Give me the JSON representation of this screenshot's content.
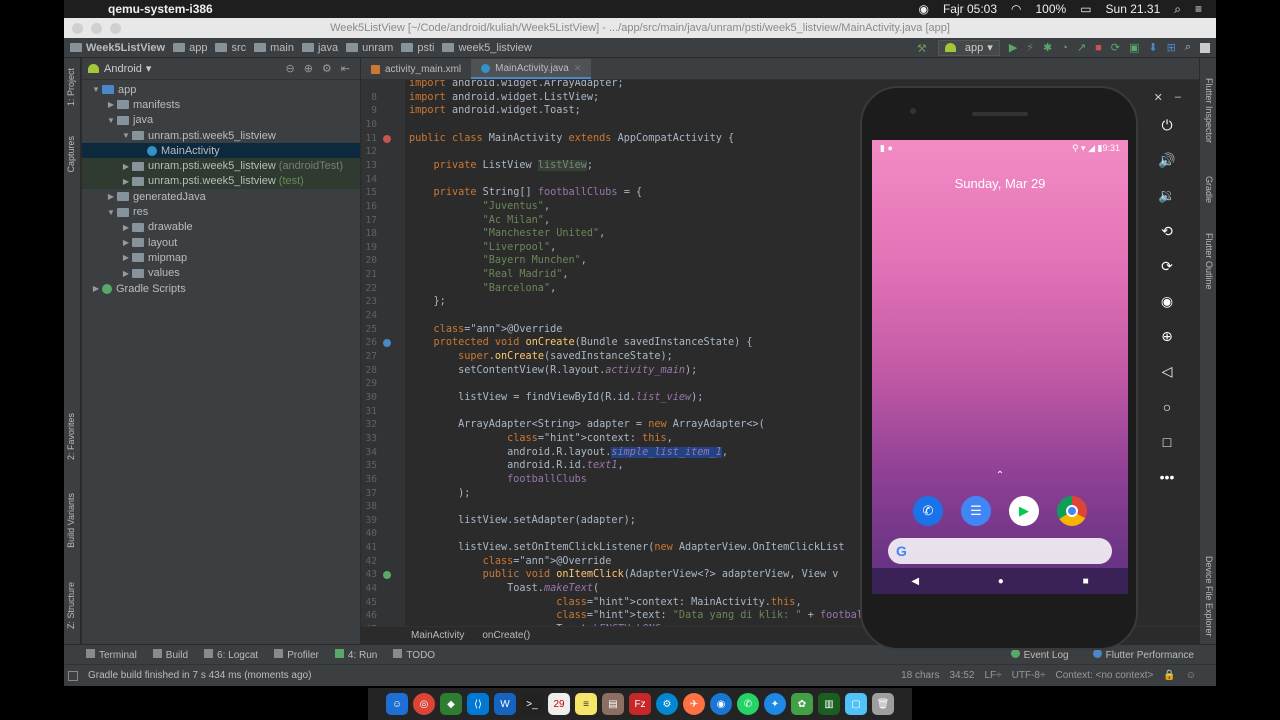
{
  "menubar": {
    "app_name": "qemu-system-i386",
    "prayer": "Fajr 05:03",
    "battery": "100%",
    "clock": "Sun 21.31"
  },
  "window": {
    "title": "Week5ListView [~/Code/android/kuliah/Week5ListView] - .../app/src/main/java/unram/psti/week5_listview/MainActivity.java [app]"
  },
  "navbar": {
    "crumbs": [
      "Week5ListView",
      "app",
      "src",
      "main",
      "java",
      "unram",
      "psti",
      "week5_listview"
    ],
    "run_config": "app"
  },
  "side_tabs": {
    "left": [
      "1: Project",
      "Captures",
      "2: Favorites",
      "Build Variants",
      "Z: Structure"
    ],
    "right": [
      "Flutter Inspector",
      "Gradle",
      "Flutter Outline",
      "Device File Explorer"
    ]
  },
  "project": {
    "view": "Android",
    "tree": [
      {
        "label": "app",
        "suffix": "",
        "depth": 0,
        "arrow": "▼",
        "icon": "module",
        "state": ""
      },
      {
        "label": "manifests",
        "suffix": "",
        "depth": 1,
        "arrow": "▶",
        "icon": "folder",
        "state": ""
      },
      {
        "label": "java",
        "suffix": "",
        "depth": 1,
        "arrow": "▼",
        "icon": "folder",
        "state": ""
      },
      {
        "label": "unram.psti.week5_listview",
        "suffix": "",
        "depth": 2,
        "arrow": "▼",
        "icon": "package",
        "state": ""
      },
      {
        "label": "MainActivity",
        "suffix": "",
        "depth": 3,
        "arrow": "",
        "icon": "class",
        "state": "selected"
      },
      {
        "label": "unram.psti.week5_listview",
        "suffix": "(androidTest)",
        "depth": 2,
        "arrow": "▶",
        "icon": "package",
        "state": "test"
      },
      {
        "label": "unram.psti.week5_listview",
        "suffix": "(test)",
        "depth": 2,
        "arrow": "▶",
        "icon": "package",
        "state": "test"
      },
      {
        "label": "generatedJava",
        "suffix": "",
        "depth": 1,
        "arrow": "▶",
        "icon": "folder",
        "state": ""
      },
      {
        "label": "res",
        "suffix": "",
        "depth": 1,
        "arrow": "▼",
        "icon": "folder",
        "state": ""
      },
      {
        "label": "drawable",
        "suffix": "",
        "depth": 2,
        "arrow": "▶",
        "icon": "folder",
        "state": ""
      },
      {
        "label": "layout",
        "suffix": "",
        "depth": 2,
        "arrow": "▶",
        "icon": "folder",
        "state": ""
      },
      {
        "label": "mipmap",
        "suffix": "",
        "depth": 2,
        "arrow": "▶",
        "icon": "folder",
        "state": ""
      },
      {
        "label": "values",
        "suffix": "",
        "depth": 2,
        "arrow": "▶",
        "icon": "folder",
        "state": ""
      },
      {
        "label": "Gradle Scripts",
        "suffix": "",
        "depth": 0,
        "arrow": "▶",
        "icon": "gradle",
        "state": ""
      }
    ]
  },
  "editor": {
    "tabs": [
      "activity_main.xml",
      "MainActivity.java"
    ],
    "active_tab": 1,
    "lines": [
      {
        "n": "",
        "t": "import android.widget.ArrayAdapter;",
        "cls": "kw"
      },
      {
        "n": "8",
        "t": "import android.widget.ListView;",
        "cls": "kw"
      },
      {
        "n": "9",
        "t": "import android.widget.Toast;",
        "cls": "kw"
      },
      {
        "n": "10",
        "t": "",
        "cls": ""
      },
      {
        "n": "11",
        "t": "public class MainActivity extends AppCompatActivity {",
        "cls": "kw"
      },
      {
        "n": "12",
        "t": "",
        "cls": ""
      },
      {
        "n": "13",
        "t": "    private ListView listView;",
        "cls": "kw"
      },
      {
        "n": "14",
        "t": "",
        "cls": ""
      },
      {
        "n": "15",
        "t": "    private String[] footballClubs = {",
        "cls": "kw"
      },
      {
        "n": "16",
        "t": "            \"Juventus\",",
        "cls": "str"
      },
      {
        "n": "17",
        "t": "            \"Ac Milan\",",
        "cls": "str"
      },
      {
        "n": "18",
        "t": "            \"Manchester United\",",
        "cls": "str"
      },
      {
        "n": "19",
        "t": "            \"Liverpool\",",
        "cls": "str"
      },
      {
        "n": "20",
        "t": "            \"Bayern Munchen\",",
        "cls": "str"
      },
      {
        "n": "21",
        "t": "            \"Real Madrid\",",
        "cls": "str"
      },
      {
        "n": "22",
        "t": "            \"Barcelona\",",
        "cls": "str"
      },
      {
        "n": "23",
        "t": "    };",
        "cls": ""
      },
      {
        "n": "24",
        "t": "",
        "cls": ""
      },
      {
        "n": "25",
        "t": "    @Override",
        "cls": "ann"
      },
      {
        "n": "26",
        "t": "    protected void onCreate(Bundle savedInstanceState) {",
        "cls": "kw"
      },
      {
        "n": "27",
        "t": "        super.onCreate(savedInstanceState);",
        "cls": ""
      },
      {
        "n": "28",
        "t": "        setContentView(R.layout.activity_main);",
        "cls": ""
      },
      {
        "n": "29",
        "t": "",
        "cls": ""
      },
      {
        "n": "30",
        "t": "        listView = findViewById(R.id.list_view);",
        "cls": ""
      },
      {
        "n": "31",
        "t": "",
        "cls": ""
      },
      {
        "n": "32",
        "t": "        ArrayAdapter<String> adapter = new ArrayAdapter<>(",
        "cls": ""
      },
      {
        "n": "33",
        "t": "                context: this,",
        "cls": ""
      },
      {
        "n": "34",
        "t": "                android.R.layout.simple_list_item_1,",
        "cls": ""
      },
      {
        "n": "35",
        "t": "                android.R.id.text1,",
        "cls": ""
      },
      {
        "n": "36",
        "t": "                footballClubs",
        "cls": ""
      },
      {
        "n": "37",
        "t": "        );",
        "cls": ""
      },
      {
        "n": "38",
        "t": "",
        "cls": ""
      },
      {
        "n": "39",
        "t": "        listView.setAdapter(adapter);",
        "cls": ""
      },
      {
        "n": "40",
        "t": "",
        "cls": ""
      },
      {
        "n": "41",
        "t": "        listView.setOnItemClickListener(new AdapterView.OnItemClickList",
        "cls": ""
      },
      {
        "n": "42",
        "t": "            @Override",
        "cls": "ann"
      },
      {
        "n": "43",
        "t": "            public void onItemClick(AdapterView<?> adapterView, View v",
        "cls": ""
      },
      {
        "n": "44",
        "t": "                Toast.makeText(",
        "cls": ""
      },
      {
        "n": "45",
        "t": "                        context: MainActivity.this,",
        "cls": ""
      },
      {
        "n": "46",
        "t": "                        text: \"Data yang di klik: \" + footballClubs[i],",
        "cls": ""
      },
      {
        "n": "47",
        "t": "                        Toast.LENGTH_LONG",
        "cls": ""
      }
    ],
    "breadcrumb": [
      "MainActivity",
      "onCreate()"
    ]
  },
  "emulator": {
    "status_time": "9:31",
    "date": "Sunday, Mar 29",
    "dock_apps": [
      "phone",
      "messages",
      "play-store",
      "chrome"
    ],
    "search_letter": "G",
    "tools": [
      "power",
      "volume-up",
      "volume-down",
      "rotate-left",
      "rotate-right",
      "screenshot",
      "zoom",
      "back",
      "home",
      "overview",
      "more"
    ]
  },
  "toolwindows": {
    "left": [
      "Terminal",
      "Build",
      "6: Logcat",
      "Profiler",
      "4: Run",
      "TODO"
    ],
    "right": [
      "Event Log",
      "Flutter Performance"
    ]
  },
  "statusbar": {
    "message": "Gradle build finished in 7 s 434 ms (moments ago)",
    "chars": "18 chars",
    "pos": "34:52",
    "lf": "LF÷",
    "enc": "UTF-8÷",
    "context": "Context: <no context>"
  },
  "colors": {
    "keyword": "#cc7832",
    "string": "#6a8759",
    "annotation": "#bbb529",
    "method": "#ffc66d",
    "field": "#9876aa",
    "background": "#2b2b2b"
  }
}
